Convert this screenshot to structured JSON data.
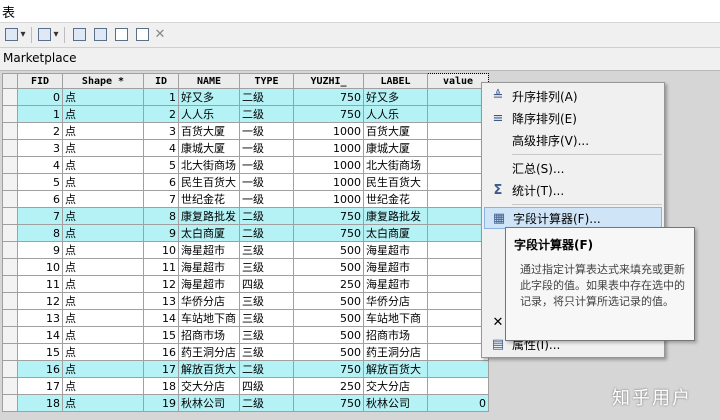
{
  "window": {
    "title": "表"
  },
  "table_name": "Marketplace",
  "columns": [
    "FID",
    "Shape *",
    "ID",
    "NAME",
    "TYPE",
    "YUZHI_",
    "LABEL",
    "value"
  ],
  "rows": [
    {
      "fid": "0",
      "shape": "点",
      "id": "1",
      "name": "好又多",
      "type": "二级",
      "yuzhi": "750",
      "label": "好又多",
      "value": "",
      "hl": true
    },
    {
      "fid": "1",
      "shape": "点",
      "id": "2",
      "name": "人人乐",
      "type": "二级",
      "yuzhi": "750",
      "label": "人人乐",
      "value": "",
      "hl": true
    },
    {
      "fid": "2",
      "shape": "点",
      "id": "3",
      "name": "百货大厦",
      "type": "一级",
      "yuzhi": "1000",
      "label": "百货大厦",
      "value": "",
      "hl": false
    },
    {
      "fid": "3",
      "shape": "点",
      "id": "4",
      "name": "康城大厦",
      "type": "一级",
      "yuzhi": "1000",
      "label": "康城大厦",
      "value": "",
      "hl": false
    },
    {
      "fid": "4",
      "shape": "点",
      "id": "5",
      "name": "北大街商场",
      "type": "一级",
      "yuzhi": "1000",
      "label": "北大街商场",
      "value": "",
      "hl": false
    },
    {
      "fid": "5",
      "shape": "点",
      "id": "6",
      "name": "民生百货大",
      "type": "一级",
      "yuzhi": "1000",
      "label": "民生百货大",
      "value": "",
      "hl": false
    },
    {
      "fid": "6",
      "shape": "点",
      "id": "7",
      "name": "世纪金花",
      "type": "一级",
      "yuzhi": "1000",
      "label": "世纪金花",
      "value": "",
      "hl": false
    },
    {
      "fid": "7",
      "shape": "点",
      "id": "8",
      "name": "康复路批发",
      "type": "二级",
      "yuzhi": "750",
      "label": "康复路批发",
      "value": "",
      "hl": true
    },
    {
      "fid": "8",
      "shape": "点",
      "id": "9",
      "name": "太白商厦",
      "type": "二级",
      "yuzhi": "750",
      "label": "太白商厦",
      "value": "",
      "hl": true
    },
    {
      "fid": "9",
      "shape": "点",
      "id": "10",
      "name": "海星超市",
      "type": "三级",
      "yuzhi": "500",
      "label": "海星超市",
      "value": "",
      "hl": false
    },
    {
      "fid": "10",
      "shape": "点",
      "id": "11",
      "name": "海星超市",
      "type": "三级",
      "yuzhi": "500",
      "label": "海星超市",
      "value": "",
      "hl": false
    },
    {
      "fid": "11",
      "shape": "点",
      "id": "12",
      "name": "海星超市",
      "type": "四级",
      "yuzhi": "250",
      "label": "海星超市",
      "value": "",
      "hl": false
    },
    {
      "fid": "12",
      "shape": "点",
      "id": "13",
      "name": "华侨分店",
      "type": "三级",
      "yuzhi": "500",
      "label": "华侨分店",
      "value": "",
      "hl": false
    },
    {
      "fid": "13",
      "shape": "点",
      "id": "14",
      "name": "车站地下商",
      "type": "三级",
      "yuzhi": "500",
      "label": "车站地下商",
      "value": "",
      "hl": false
    },
    {
      "fid": "14",
      "shape": "点",
      "id": "15",
      "name": "招商市场",
      "type": "三级",
      "yuzhi": "500",
      "label": "招商市场",
      "value": "",
      "hl": false
    },
    {
      "fid": "15",
      "shape": "点",
      "id": "16",
      "name": "药王洞分店",
      "type": "三级",
      "yuzhi": "500",
      "label": "药王洞分店",
      "value": "",
      "hl": false
    },
    {
      "fid": "16",
      "shape": "点",
      "id": "17",
      "name": "解放百货大",
      "type": "二级",
      "yuzhi": "750",
      "label": "解放百货大",
      "value": "",
      "hl": true
    },
    {
      "fid": "17",
      "shape": "点",
      "id": "18",
      "name": "交大分店",
      "type": "四级",
      "yuzhi": "250",
      "label": "交大分店",
      "value": "",
      "hl": false
    },
    {
      "fid": "18",
      "shape": "点",
      "id": "19",
      "name": "秋林公司",
      "type": "二级",
      "yuzhi": "750",
      "label": "秋林公司",
      "value": "0",
      "hl": true
    }
  ],
  "context_menu": {
    "items": [
      {
        "label": "升序排列(A)",
        "icon": "sort-ascending-icon"
      },
      {
        "label": "降序排列(E)",
        "icon": "sort-descending-icon"
      },
      {
        "label": "高级排序(V)...",
        "icon": ""
      },
      {
        "label": "汇总(S)...",
        "icon": ""
      },
      {
        "label": "统计(T)...",
        "icon": "sigma-icon"
      },
      {
        "label": "字段计算器(F)...",
        "icon": "field-calculator-icon"
      },
      {
        "label": "属性(I)...",
        "icon": "properties-icon"
      }
    ]
  },
  "tooltip": {
    "title": "字段计算器(F)",
    "body": "通过指定计算表达式来填充或更新此字段的值。如果表中存在选中的记录，将只计算所选记录的值。"
  },
  "watermark": "知乎用户",
  "colors": {
    "highlight_row": "#b4f2f6",
    "menu_hover": "#cfe4f7"
  }
}
